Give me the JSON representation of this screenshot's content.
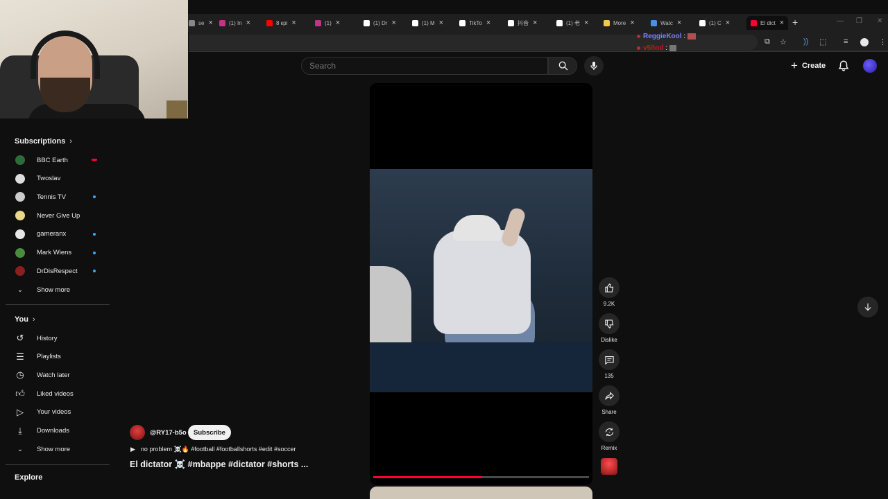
{
  "browser": {
    "tabs": [
      {
        "label": "se",
        "color": "#888888"
      },
      {
        "label": "(1) In",
        "color": "#c13584"
      },
      {
        "label": "8 крi",
        "color": "#ff0000"
      },
      {
        "label": "(1)",
        "color": "#c13584"
      },
      {
        "label": "(1) Dr",
        "color": "#ffffff"
      },
      {
        "label": "(1) M",
        "color": "#ffffff"
      },
      {
        "label": "TikTo",
        "color": "#ffffff"
      },
      {
        "label": "抖音",
        "color": "#ffffff"
      },
      {
        "label": "(1) 老",
        "color": "#ffffff"
      },
      {
        "label": "More",
        "color": "#f2c94c"
      },
      {
        "label": "Watc",
        "color": "#4a90e2"
      },
      {
        "label": "(1) C",
        "color": "#ffffff"
      },
      {
        "label": "El dict",
        "color": "#ff0033"
      }
    ],
    "new_tab": "+",
    "chat": [
      {
        "user": "ReggieKool",
        "sep": ":"
      },
      {
        "user": "v5ñnd",
        "sep": ":"
      }
    ]
  },
  "header": {
    "search_placeholder": "Search",
    "create_label": "Create",
    "icons": [
      "search-icon",
      "microphone-icon",
      "plus-icon",
      "bell-icon",
      "avatar"
    ]
  },
  "sidebar": {
    "subscriptions_title": "Subscriptions",
    "subscriptions": [
      {
        "label": "BBC Earth",
        "color": "#2e6b3a",
        "badge": "live"
      },
      {
        "label": "Twoslav",
        "color": "#dddddd",
        "badge": ""
      },
      {
        "label": "Tennis TV",
        "color": "#cccccc",
        "badge": "dot"
      },
      {
        "label": "Never Give Up",
        "color": "#e8d88a",
        "badge": ""
      },
      {
        "label": "gameranx",
        "color": "#e6e6e6",
        "badge": "dot"
      },
      {
        "label": "Mark Wiens",
        "color": "#4b8c3c",
        "badge": "dot"
      },
      {
        "label": "DrDisRespect",
        "color": "#8b1e1e",
        "badge": "dot"
      }
    ],
    "show_more_1": "Show more",
    "you_title": "You",
    "you_items": [
      {
        "label": "History",
        "icon": "history-icon"
      },
      {
        "label": "Playlists",
        "icon": "playlists-icon"
      },
      {
        "label": "Watch later",
        "icon": "watch-later-icon"
      },
      {
        "label": "Liked videos",
        "icon": "thumbs-up-icon"
      },
      {
        "label": "Your videos",
        "icon": "your-videos-icon"
      },
      {
        "label": "Downloads",
        "icon": "download-icon"
      }
    ],
    "show_more_2": "Show more",
    "explore_title": "Explore"
  },
  "short": {
    "channel": "@RY17-b5o",
    "subscribe_label": "Subscribe",
    "description": "no problem ☠️🔥 #football #footballshorts #edit #soccer",
    "title": "El dictator ☠️ #mbappe #dictator #shorts ...",
    "progress": 0.5
  },
  "actions": {
    "like_count": "9.2K",
    "dislike_label": "Dislike",
    "comment_count": "135",
    "share_label": "Share",
    "remix_label": "Remix"
  },
  "colors": {
    "background": "#0f0f0f",
    "accent_red": "#ff0033",
    "subscribe_bg": "#f1f1f1"
  }
}
